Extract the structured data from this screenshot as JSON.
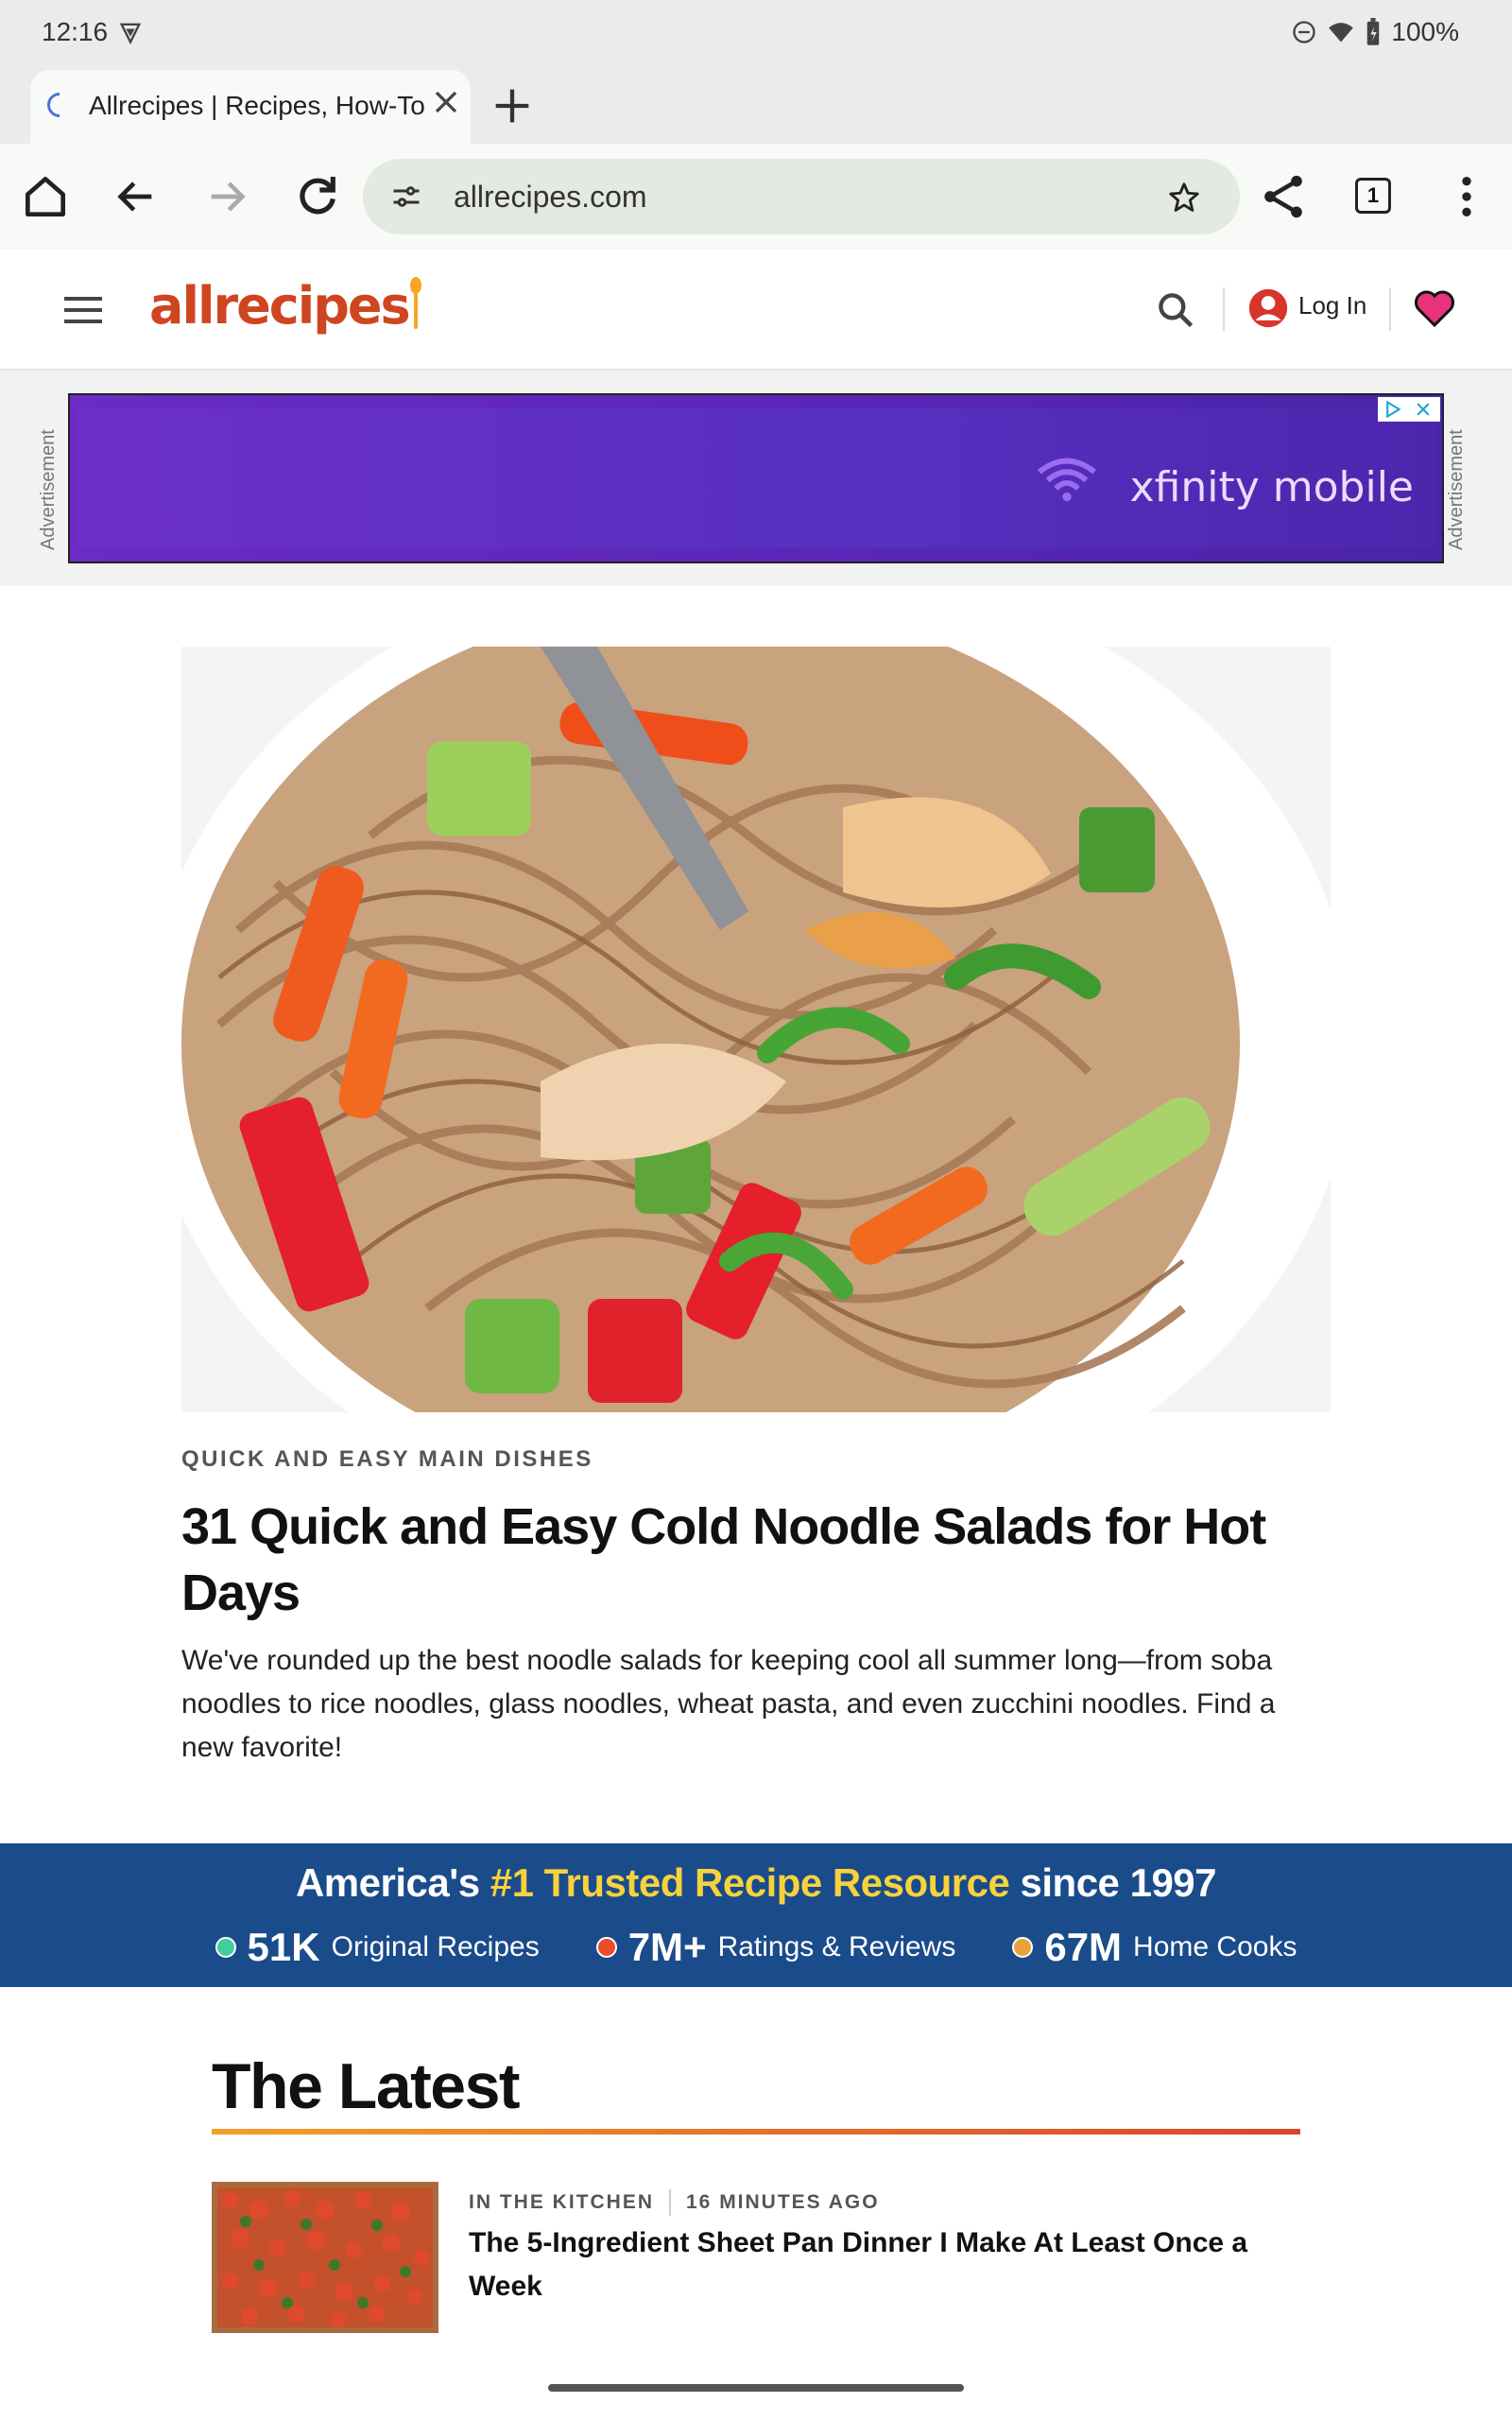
{
  "status_bar": {
    "time": "12:16",
    "battery": "100%"
  },
  "browser": {
    "tab_title": "Allrecipes | Recipes, How-To",
    "url": "allrecipes.com",
    "tab_count": "1"
  },
  "site": {
    "logo": "allrecipes",
    "login_label": "Log In",
    "ad_label": "Advertisement",
    "ad_brand": "xfinity mobile"
  },
  "hero": {
    "category": "QUICK AND EASY MAIN DISHES",
    "headline": "31 Quick and Easy Cold Noodle Salads for Hot Days",
    "dek": "We've rounded up the best noodle salads for keeping cool all summer long—from soba noodles to rice noodles, glass noodles, wheat pasta, and even zucchini noodles. Find a new favorite!"
  },
  "trust": {
    "prefix": "America's",
    "highlight": "#1 Trusted Recipe Resource",
    "suffix": "since 1997",
    "stats": [
      {
        "num": "51K",
        "label": "Original Recipes",
        "color": "#3fcf9c"
      },
      {
        "num": "7M+",
        "label": "Ratings & Reviews",
        "color": "#e84c2b"
      },
      {
        "num": "67M",
        "label": "Home Cooks",
        "color": "#e8a23c"
      }
    ]
  },
  "latest": {
    "title": "The Latest",
    "article": {
      "category": "IN THE KITCHEN",
      "time": "16 MINUTES AGO",
      "title": "The 5-Ingredient Sheet Pan Dinner I Make At Least Once a Week"
    }
  }
}
